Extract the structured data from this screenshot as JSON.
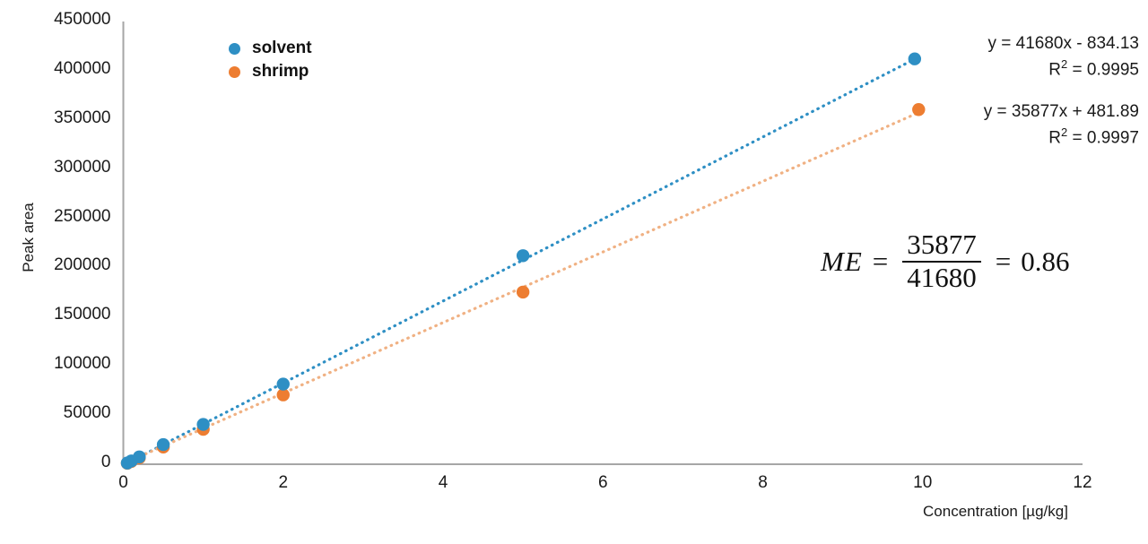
{
  "chart_data": {
    "type": "scatter",
    "title": "",
    "xlabel": "Concentration [µg/kg]",
    "ylabel": "Peak area",
    "xlim": [
      0,
      12
    ],
    "ylim": [
      0,
      450000
    ],
    "xticks": [
      "0",
      "2",
      "4",
      "6",
      "8",
      "10",
      "12"
    ],
    "xtick_values": [
      0,
      2,
      4,
      6,
      8,
      10,
      12
    ],
    "yticks": [
      "0",
      "50000",
      "100000",
      "150000",
      "200000",
      "250000",
      "300000",
      "350000",
      "400000",
      "450000"
    ],
    "ytick_values": [
      0,
      50000,
      100000,
      150000,
      200000,
      250000,
      300000,
      350000,
      400000,
      450000
    ],
    "grid": false,
    "legend_position": "top-left",
    "series": [
      {
        "name": "solvent",
        "color": "#2e8fc4",
        "marker": "circle",
        "trendline": "dotted",
        "x": [
          0.05,
          0.1,
          0.2,
          0.5,
          1,
          2,
          5,
          9.9
        ],
        "y": [
          1250,
          3330,
          7500,
          20000,
          40500,
          81500,
          212000,
          412000
        ],
        "equation": "y = 41680x - 834.13",
        "r_squared_label": "R² = 0.9995",
        "slope": 41680,
        "intercept": -834.13,
        "r_squared": 0.9995
      },
      {
        "name": "shrimp",
        "color": "#ed7d31",
        "marker": "circle",
        "trendline": "dotted",
        "x": [
          0.05,
          0.1,
          0.2,
          0.5,
          1,
          2,
          5,
          9.95
        ],
        "y": [
          1000,
          2800,
          6500,
          17500,
          35500,
          70500,
          175000,
          360500
        ],
        "equation": "y = 35877x + 481.89",
        "r_squared_label": "R² = 0.9997",
        "slope": 35877,
        "intercept": 481.89,
        "r_squared": 0.9997
      }
    ],
    "annotations": [
      {
        "name": "matrix-effect-formula",
        "symbol": "ME",
        "equals": "=",
        "numerator": "35877",
        "denominator": "41680",
        "result_equals": "=",
        "result": "0.86"
      }
    ]
  },
  "legend": {
    "items": [
      {
        "label": "solvent",
        "color": "#2e8fc4"
      },
      {
        "label": "shrimp",
        "color": "#ed7d31"
      }
    ]
  },
  "equations": {
    "solvent": {
      "line1": "y = 41680x - 834.13",
      "r2_prefix": "R",
      "r2_sup": "2",
      "r2_value": " = 0.9995"
    },
    "shrimp": {
      "line1": "y = 35877x + 481.89",
      "r2_prefix": "R",
      "r2_sup": "2",
      "r2_value": " = 0.9997"
    }
  },
  "me": {
    "symbol": "ME",
    "equals": "=",
    "numerator": "35877",
    "denominator": "41680",
    "result_equals": "=",
    "result": "0.86"
  },
  "colors": {
    "solvent": "#2e8fc4",
    "shrimp": "#ed7d31",
    "axis": "#a6a6a6",
    "text": "#1a1a1a"
  }
}
